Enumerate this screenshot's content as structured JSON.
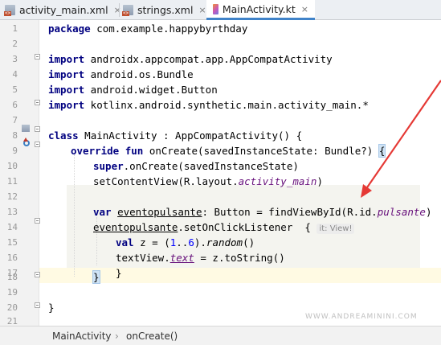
{
  "tabs": [
    {
      "label": "activity_main.xml",
      "icon": "xml-file-icon",
      "active": false
    },
    {
      "label": "strings.xml",
      "icon": "xml-file-icon",
      "active": false
    },
    {
      "label": "MainActivity.kt",
      "icon": "kotlin-file-icon",
      "active": true
    }
  ],
  "close_glyph": "×",
  "code": {
    "l1": {
      "n": "1",
      "kw": "package",
      "rest": " com.example.happybyrthday"
    },
    "l2": {
      "n": "2"
    },
    "l3": {
      "n": "3",
      "kw": "import",
      "rest": " androidx.appcompat.app.AppCompatActivity"
    },
    "l4": {
      "n": "4",
      "kw": "import",
      "rest": " android.os.Bundle"
    },
    "l5": {
      "n": "5",
      "kw": "import",
      "rest": " android.widget.Button"
    },
    "l6": {
      "n": "6",
      "kw": "import",
      "rest": " kotlinx.android.synthetic.main.activity_main.*"
    },
    "l7": {
      "n": "7"
    },
    "l8": {
      "n": "8",
      "kw": "class",
      "rest": " MainActivity : AppCompatActivity() {"
    },
    "l9": {
      "n": "9",
      "kw": "override fun",
      "rest": " onCreate(savedInstanceState: Bundle?) ",
      "brace": "{"
    },
    "l10": {
      "n": "10",
      "kw": "super",
      "rest": ".onCreate(savedInstanceState)"
    },
    "l11": {
      "n": "11",
      "pre": "setContentView(R.layout.",
      "fld": "activity_main",
      "post": ")"
    },
    "l12": {
      "n": "12"
    },
    "l13": {
      "n": "13",
      "kw": "var",
      "ident": "eventopulsante",
      "mid": ": Button = findViewById(R.id.",
      "fld": "pulsante",
      "post": ")"
    },
    "l14": {
      "n": "14",
      "ident": "eventopulsante",
      "post": ".setOnClickListener  {",
      "hint": "it: View!"
    },
    "l15": {
      "n": "15",
      "kw": "val",
      "pre": " z = (",
      "num1": "1",
      "dots": "..",
      "num2": "6",
      "mid": ").",
      "fn": "random",
      "post": "()"
    },
    "l16": {
      "n": "16",
      "pre": "textView.",
      "fld": "text",
      "post": " = z.toString()"
    },
    "l17": {
      "n": "17",
      "text": "}"
    },
    "l18": {
      "n": "18",
      "text": "}"
    },
    "l19": {
      "n": "19"
    },
    "l20": {
      "n": "20",
      "text": "}"
    },
    "l21": {
      "n": "21"
    }
  },
  "breadcrumb": {
    "class": "MainActivity",
    "sep": "›",
    "method": "onCreate()"
  },
  "watermark": "WWW.ANDREAMININI.COM",
  "colors": {
    "keyword": "#000080",
    "field": "#660e7a",
    "number": "#0000ff",
    "arrow": "#e53935",
    "tab_accent": "#4083c9"
  }
}
